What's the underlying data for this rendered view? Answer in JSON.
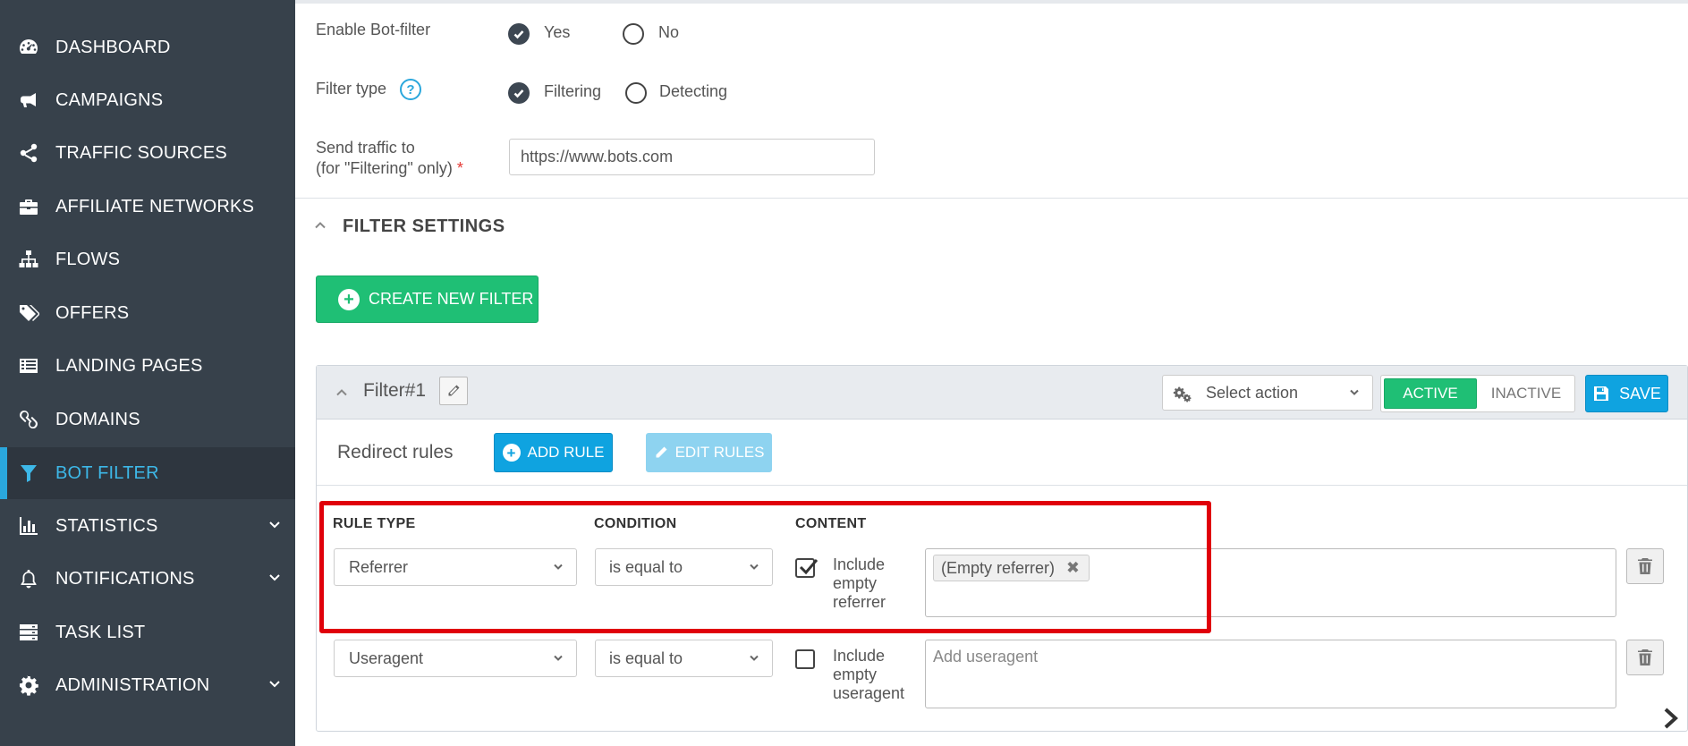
{
  "sidebar": {
    "items": [
      {
        "label": "DASHBOARD",
        "icon": "dashboard-icon"
      },
      {
        "label": "CAMPAIGNS",
        "icon": "megaphone-icon"
      },
      {
        "label": "TRAFFIC SOURCES",
        "icon": "share-icon"
      },
      {
        "label": "AFFILIATE NETWORKS",
        "icon": "briefcase-icon"
      },
      {
        "label": "FLOWS",
        "icon": "sitemap-icon"
      },
      {
        "label": "OFFERS",
        "icon": "tags-icon"
      },
      {
        "label": "LANDING PAGES",
        "icon": "list-icon"
      },
      {
        "label": "DOMAINS",
        "icon": "link-icon"
      },
      {
        "label": "BOT FILTER",
        "icon": "filter-icon",
        "active": true
      },
      {
        "label": "STATISTICS",
        "icon": "bar-chart-icon",
        "expandable": true
      },
      {
        "label": "NOTIFICATIONS",
        "icon": "bell-icon",
        "expandable": true
      },
      {
        "label": "TASK LIST",
        "icon": "server-icon"
      },
      {
        "label": "ADMINISTRATION",
        "icon": "gear-icon",
        "expandable": true
      }
    ],
    "active_color": "#3db8e8",
    "background": "#37414b"
  },
  "settings": {
    "enable_label": "Enable Bot-filter",
    "enable_yes": "Yes",
    "enable_no": "No",
    "enable_value": "Yes",
    "filter_type_label": "Filter type",
    "filter_type_help": "?",
    "filter_type_filtering": "Filtering",
    "filter_type_detecting": "Detecting",
    "filter_type_value": "Filtering",
    "send_traffic_label_1": "Send traffic to",
    "send_traffic_label_2": "(for \"Filtering\" only)",
    "required_mark": "*",
    "send_traffic_value": "https://www.bots.com"
  },
  "filter_settings": {
    "title": "FILTER SETTINGS",
    "create_button": "CREATE NEW FILTER"
  },
  "filter": {
    "title": "Filter#1",
    "select_action": "Select action",
    "status_active": "ACTIVE",
    "status_inactive": "INACTIVE",
    "status_value": "ACTIVE",
    "save_button": "SAVE",
    "redirect_rules_label": "Redirect rules",
    "add_rule_button": "ADD RULE",
    "edit_rules_button": "EDIT RULES",
    "columns": {
      "rule_type": "RULE TYPE",
      "condition": "CONDITION",
      "content": "CONTENT"
    },
    "rules": [
      {
        "rule_type": "Referrer",
        "condition": "is equal to",
        "include_checked": true,
        "include_label": [
          "Include",
          "empty",
          "referrer"
        ],
        "tags": [
          "(Empty referrer)"
        ],
        "placeholder": ""
      },
      {
        "rule_type": "Useragent",
        "condition": "is equal to",
        "include_checked": false,
        "include_label": [
          "Include",
          "empty",
          "useragent"
        ],
        "tags": [],
        "placeholder": "Add useragent"
      }
    ]
  },
  "colors": {
    "green": "#1fbf75",
    "blue": "#0fa3e0",
    "highlight": "#e0000a"
  }
}
